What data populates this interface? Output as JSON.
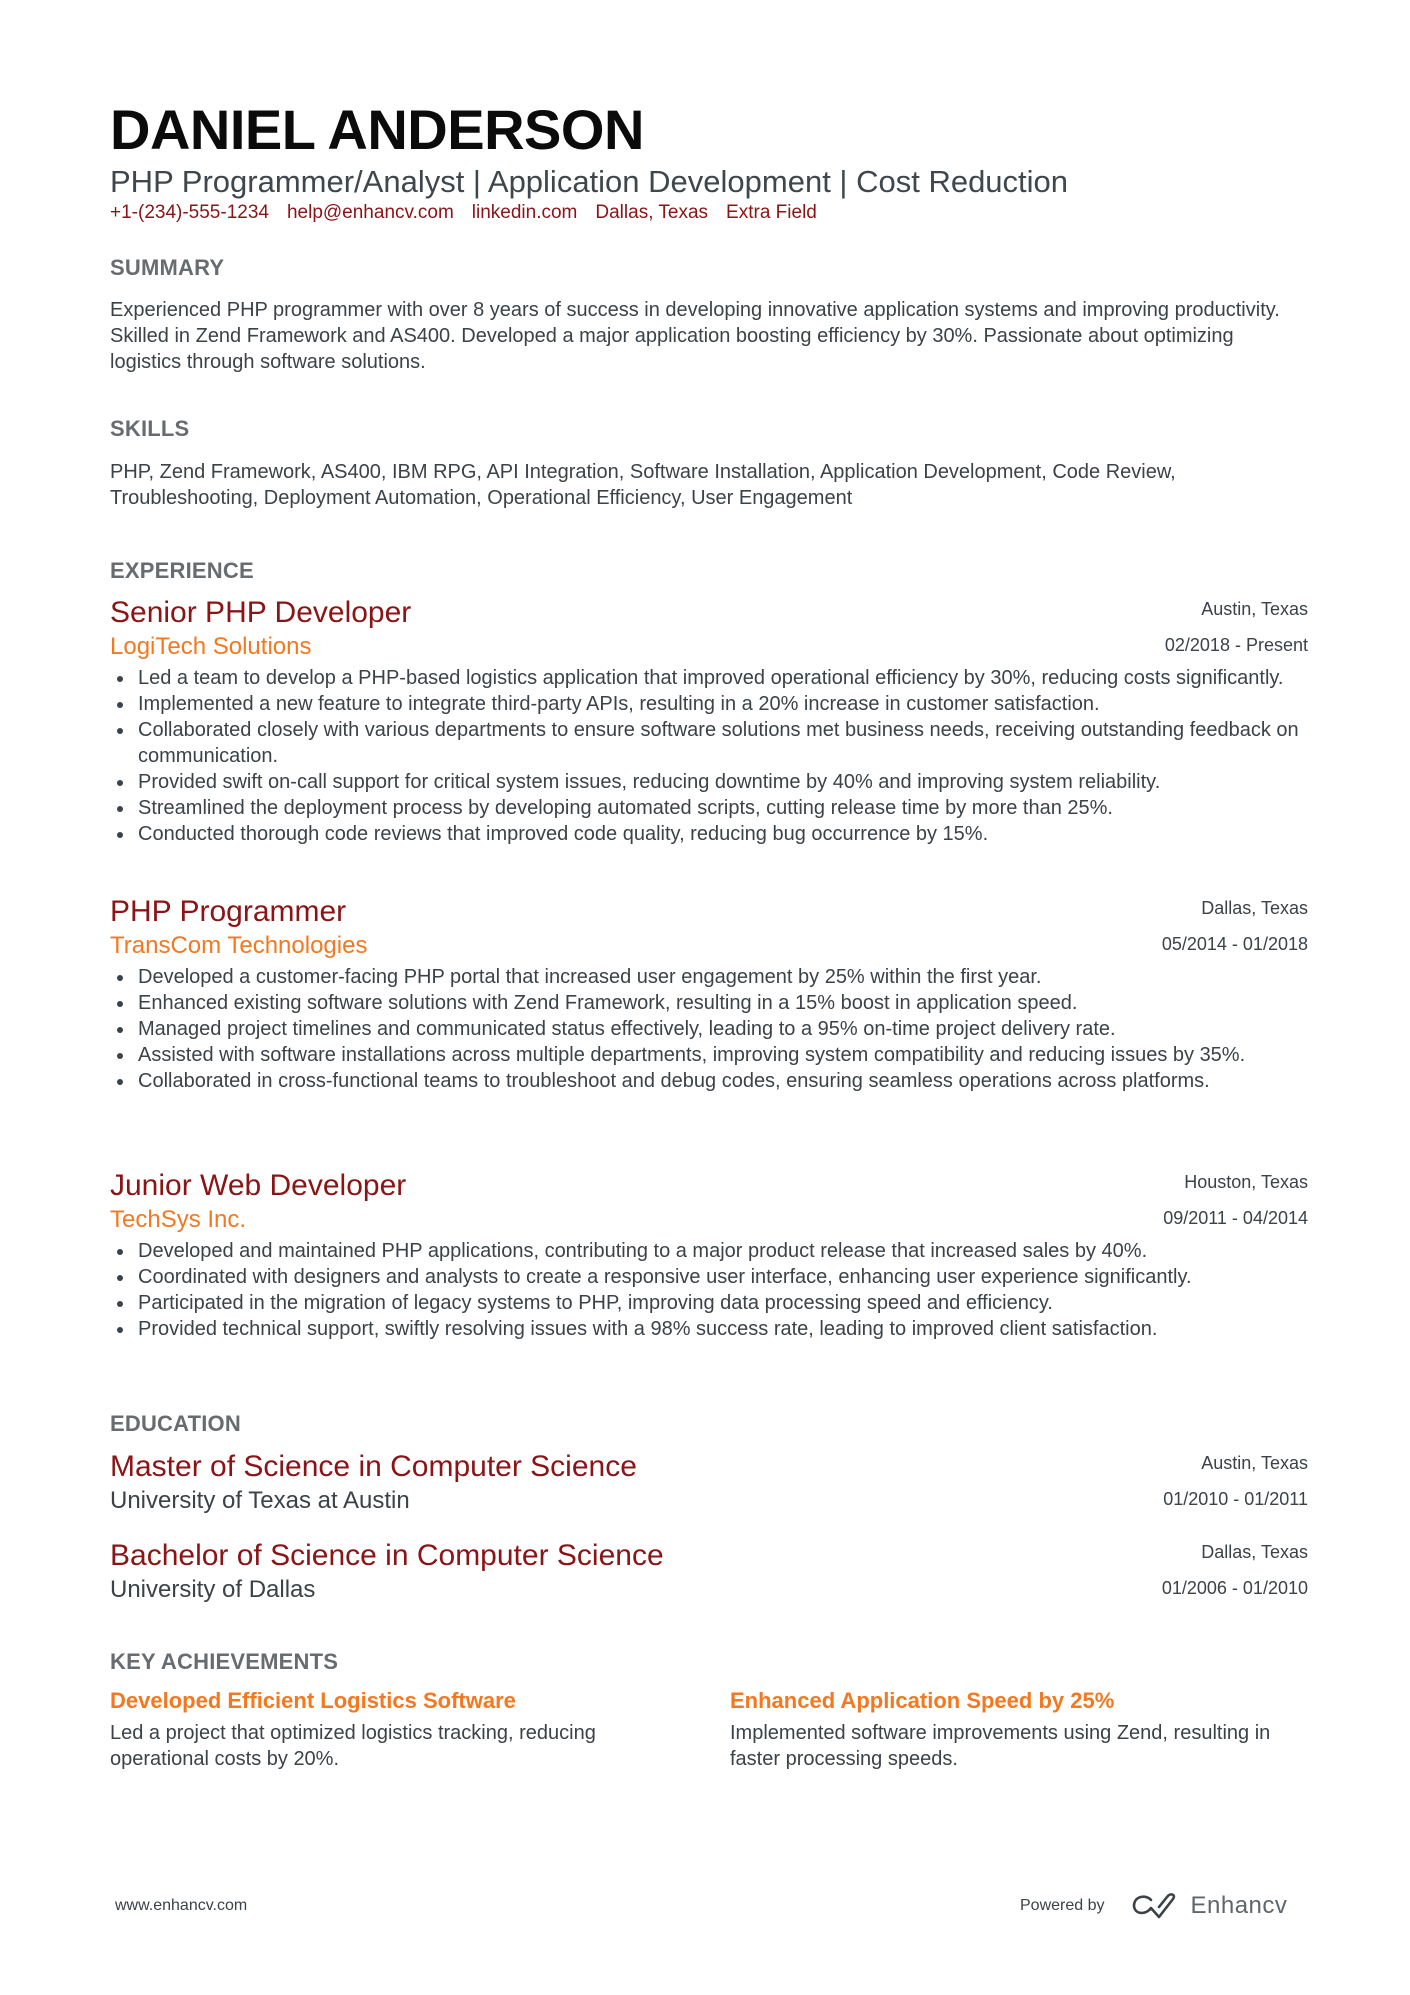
{
  "header": {
    "name": "DANIEL ANDERSON",
    "headline": "PHP Programmer/Analyst | Application Development | Cost Reduction",
    "contacts": [
      "+1-(234)-555-1234",
      "help@enhancv.com",
      "linkedin.com",
      "Dallas, Texas",
      "Extra Field"
    ]
  },
  "summary": {
    "title": "SUMMARY",
    "text": "Experienced PHP programmer with over 8 years of success in developing innovative application systems and improving productivity. Skilled in Zend Framework and AS400. Developed a major application boosting efficiency by 30%. Passionate about optimizing logistics through software solutions."
  },
  "skills": {
    "title": "SKILLS",
    "text": "PHP, Zend Framework, AS400, IBM RPG, API Integration, Software Installation, Application Development, Code Review, Troubleshooting, Deployment Automation, Operational Efficiency, User Engagement"
  },
  "experience": {
    "title": "EXPERIENCE",
    "jobs": [
      {
        "role": "Senior PHP Developer",
        "company": "LogiTech Solutions",
        "location": "Austin, Texas",
        "dates": "02/2018 - Present",
        "bullets": [
          "Led a team to develop a PHP-based logistics application that improved operational efficiency by 30%, reducing costs significantly.",
          "Implemented a new feature to integrate third-party APIs, resulting in a 20% increase in customer satisfaction.",
          "Collaborated closely with various departments to ensure software solutions met business needs, receiving outstanding feedback on communication.",
          "Provided swift on-call support for critical system issues, reducing downtime by 40% and improving system reliability.",
          "Streamlined the deployment process by developing automated scripts, cutting release time by more than 25%.",
          "Conducted thorough code reviews that improved code quality, reducing bug occurrence by 15%."
        ]
      },
      {
        "role": "PHP Programmer",
        "company": "TransCom Technologies",
        "location": "Dallas, Texas",
        "dates": "05/2014 - 01/2018",
        "bullets": [
          "Developed a customer-facing PHP portal that increased user engagement by 25% within the first year.",
          "Enhanced existing software solutions with Zend Framework, resulting in a 15% boost in application speed.",
          "Managed project timelines and communicated status effectively, leading to a 95% on-time project delivery rate.",
          "Assisted with software installations across multiple departments, improving system compatibility and reducing issues by 35%.",
          "Collaborated in cross-functional teams to troubleshoot and debug codes, ensuring seamless operations across platforms."
        ]
      },
      {
        "role": "Junior Web Developer",
        "company": "TechSys Inc.",
        "location": "Houston, Texas",
        "dates": "09/2011 - 04/2014",
        "bullets": [
          "Developed and maintained PHP applications, contributing to a major product release that increased sales by 40%.",
          "Coordinated with designers and analysts to create a responsive user interface, enhancing user experience significantly.",
          "Participated in the migration of legacy systems to PHP, improving data processing speed and efficiency.",
          "Provided technical support, swiftly resolving issues with a 98% success rate, leading to improved client satisfaction."
        ]
      }
    ]
  },
  "education": {
    "title": "EDUCATION",
    "items": [
      {
        "degree": "Master of Science in Computer Science",
        "school": "University of Texas at Austin",
        "location": "Austin, Texas",
        "dates": "01/2010 - 01/2011"
      },
      {
        "degree": "Bachelor of Science in Computer Science",
        "school": "University of Dallas",
        "location": "Dallas, Texas",
        "dates": "01/2006 - 01/2010"
      }
    ]
  },
  "achievements": {
    "title": "KEY ACHIEVEMENTS",
    "items": [
      {
        "title": "Developed Efficient Logistics Software",
        "text": "Led a project that optimized logistics tracking, reducing operational costs by 20%."
      },
      {
        "title": "Enhanced Application Speed by 25%",
        "text": "Implemented software improvements using Zend, resulting in faster processing speeds."
      }
    ]
  },
  "footer": {
    "website": "www.enhancv.com",
    "powered_by": "Powered by",
    "brand": "Enhancv",
    "brand_icon": "enhancv-logo-icon"
  },
  "colors": {
    "accent_red": "#8a1416",
    "accent_orange": "#f47820",
    "section_gray": "#676c70",
    "body_text": "#3b4248"
  }
}
